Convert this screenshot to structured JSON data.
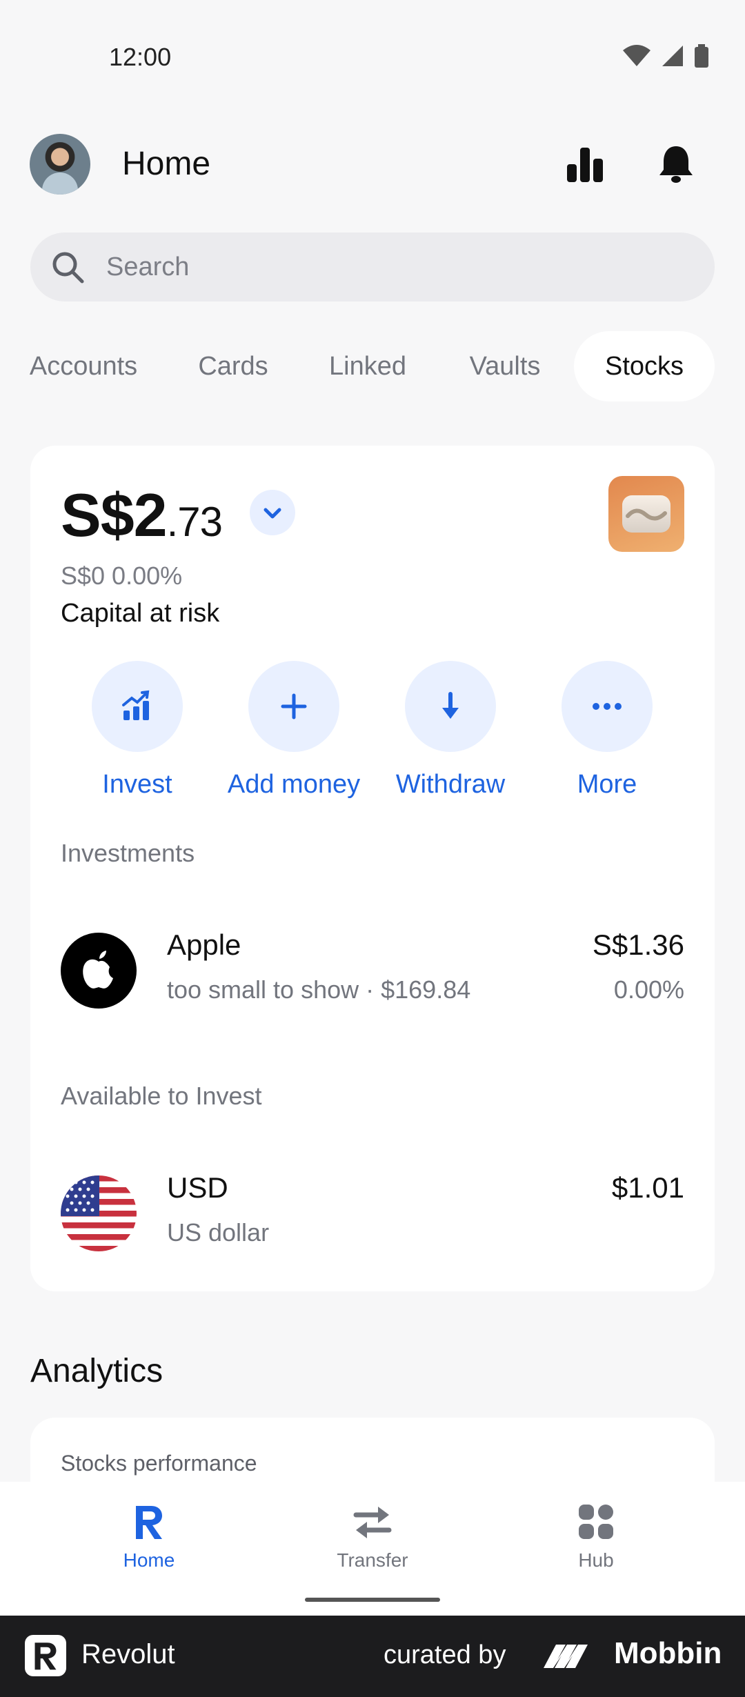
{
  "status_bar": {
    "time": "12:00"
  },
  "header": {
    "title": "Home"
  },
  "search": {
    "placeholder": "Search"
  },
  "tabs": [
    {
      "label": "Accounts",
      "active": false
    },
    {
      "label": "Cards",
      "active": false
    },
    {
      "label": "Linked",
      "active": false
    },
    {
      "label": "Vaults",
      "active": false
    },
    {
      "label": "Stocks",
      "active": true
    }
  ],
  "balance": {
    "main": "S$2",
    "cents": ".73",
    "change": "S$0 0.00%",
    "risk_note": "Capital at risk"
  },
  "actions": [
    {
      "label": "Invest",
      "icon": "chart-up-icon"
    },
    {
      "label": "Add money",
      "icon": "plus-icon"
    },
    {
      "label": "Withdraw",
      "icon": "arrow-down-icon"
    },
    {
      "label": "More",
      "icon": "more-dots-icon"
    }
  ],
  "investments": {
    "section_label": "Investments",
    "items": [
      {
        "name": "Apple",
        "subtitle": "too small to show · $169.84",
        "value": "S$1.36",
        "change": "0.00%",
        "icon": "apple-logo-icon"
      }
    ]
  },
  "available": {
    "section_label": "Available to Invest",
    "items": [
      {
        "name": "USD",
        "subtitle": "US dollar",
        "value": "$1.01",
        "icon": "us-flag-icon"
      }
    ]
  },
  "analytics": {
    "title": "Analytics",
    "card_label": "Stocks performance"
  },
  "bottom_nav": [
    {
      "label": "Home",
      "active": true,
      "icon": "revolut-r-icon"
    },
    {
      "label": "Transfer",
      "active": false,
      "icon": "transfer-arrows-icon"
    },
    {
      "label": "Hub",
      "active": false,
      "icon": "grid-icon"
    }
  ],
  "footer": {
    "brand": "Revolut",
    "curated_by": "curated by",
    "curator": "Mobbin"
  },
  "colors": {
    "accent": "#1e63e0",
    "background": "#f7f7f8",
    "card": "#ffffff"
  }
}
